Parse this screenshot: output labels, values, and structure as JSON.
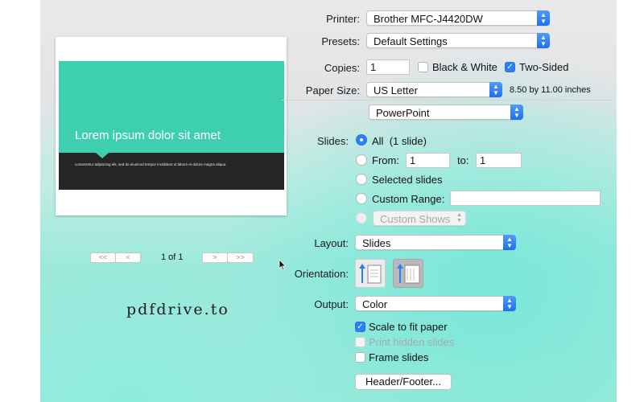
{
  "printer": {
    "label": "Printer:",
    "value": "Brother MFC-J4420DW"
  },
  "presets": {
    "label": "Presets:",
    "value": "Default Settings"
  },
  "copies": {
    "label": "Copies:",
    "value": "1",
    "black_white": "Black & White",
    "black_white_checked": false,
    "two_sided": "Two-Sided",
    "two_sided_checked": true
  },
  "paper": {
    "label": "Paper Size:",
    "value": "US Letter",
    "dimensions": "8.50 by 11.00 inches"
  },
  "app_menu": {
    "value": "PowerPoint"
  },
  "slides": {
    "label": "Slides:",
    "all": "All",
    "all_count": "(1 slide)",
    "from": "From:",
    "from_value": "1",
    "to": "to:",
    "to_value": "1",
    "selected": "Selected slides",
    "custom_range": "Custom Range:",
    "custom_shows": "Custom Shows"
  },
  "layout": {
    "label": "Layout:",
    "value": "Slides"
  },
  "orientation": {
    "label": "Orientation:"
  },
  "output": {
    "label": "Output:",
    "value": "Color"
  },
  "options": {
    "scale_to_fit": "Scale to fit paper",
    "print_hidden": "Print hidden slides",
    "frame_slides": "Frame slides"
  },
  "header_footer_button": "Header/Footer...",
  "preview": {
    "slide_title": "Lorem ipsum dolor sit amet",
    "slide_body": "consectetur adipiscing elit, sed do eiusmod tempor incididunt ut labore et dolore magna aliqua.",
    "page_indicator": "1 of 1",
    "first_btn": "<<",
    "prev_btn": "<",
    "next_btn": ">",
    "last_btn": ">>"
  },
  "watermark": "pdfdrive.to",
  "colors": {
    "accent": "#2c7ff5",
    "slide_teal": "#3ecfb1",
    "slide_dark": "#262626"
  }
}
